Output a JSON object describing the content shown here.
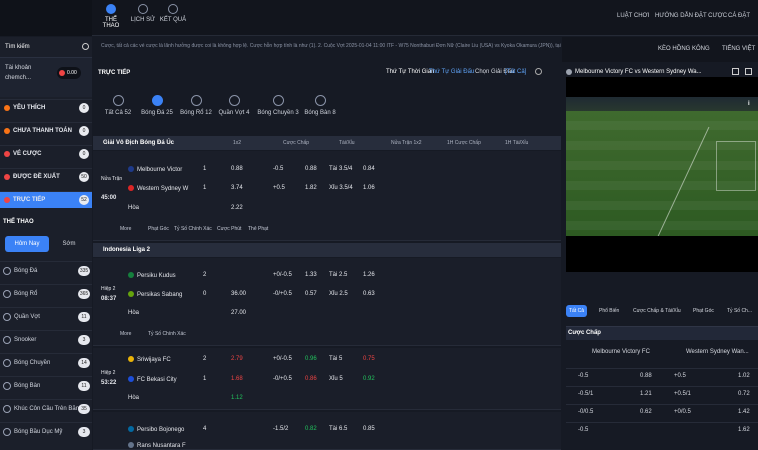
{
  "topnav": {
    "tabs": [
      {
        "label": "THỂ THAO"
      },
      {
        "label": "LỊCH SỬ"
      },
      {
        "label": "KẾT QUẢ"
      }
    ],
    "links": {
      "logout": "LUẬT CHƠI",
      "guide": "HƯỚNG DẪN ĐẶT CƯỢC",
      "odds_type": "CÁ ĐẶT"
    }
  },
  "sidebar": {
    "search_label": "Tìm kiếm",
    "account_label": "Tài khoản",
    "account_name": "chemch...",
    "balance": "0.00",
    "menu": [
      {
        "label": "YÊU THÍCH",
        "count": "0",
        "color": "#f97316"
      },
      {
        "label": "CHƯA THANH TOÁN",
        "count": "0",
        "color": "#f97316"
      },
      {
        "label": "VÉ CƯỢC",
        "count": "0",
        "color": "#ef4444"
      },
      {
        "label": "ĐƯỢC ĐỀ XUẤT",
        "count": "50",
        "color": "#ef4444"
      },
      {
        "label": "TRỰC TIẾP",
        "count": "52",
        "color": "#3b82f6"
      }
    ],
    "sports_heading": "THỂ THAO",
    "day_tabs": {
      "today": "Hôm Nay",
      "early": "Sớm"
    },
    "sports": [
      {
        "label": "Bóng Đá",
        "count": "335"
      },
      {
        "label": "Bóng Rổ",
        "count": "365"
      },
      {
        "label": "Quần Vợt",
        "count": "11"
      },
      {
        "label": "Snooker",
        "count": "3"
      },
      {
        "label": "Bóng Chuyền",
        "count": "14"
      },
      {
        "label": "Bóng Bàn",
        "count": "11"
      },
      {
        "label": "Khúc Côn Cầu Trên Băng",
        "count": "35"
      },
      {
        "label": "Bóng Bầu Dục Mỹ",
        "count": "3"
      }
    ]
  },
  "ticker": "Cược, tất cả các vé cược là lãnh hưởng được coi là không hợp lệ. Cược hỗn hợp tính là như (1). 2. Cuộc Vợt 2025-01-04 11:00 ITF - W75 Nonthaburi Đơn Nữ (Claire Liu (USA) vs Kyoka Okamura (JPN)), tại Bồ Cước. Tất cả các vé cược được hoàn trả",
  "header": {
    "title": "TRỰC TIẾP",
    "sort_label": "Thứ Tự Thời Gian",
    "sort2": "Thứ Tự Giải Đấu",
    "league_select": "Chọn Giải Đấu",
    "all_tag": "[Tất Cả]",
    "lang_select": "KÈO HỒNG KÔNG",
    "language": "TIẾNG VIỆT"
  },
  "sport_tabs": [
    {
      "label": "Tất Cả 52"
    },
    {
      "label": "Bóng Đá 25"
    },
    {
      "label": "Bóng Rổ 12"
    },
    {
      "label": "Quần Vợt 4"
    },
    {
      "label": "Bóng Chuyền 3"
    },
    {
      "label": "Bóng Bàn 8"
    }
  ],
  "columns": {
    "c1x2": "1x2",
    "handicap": "Cược Chấp",
    "ou": "Tài/Xỉu",
    "h1x2": "Nửa Trận 1x2",
    "hhandicap": "1H Cược Chấp",
    "hou": "1H Tài/Xỉu"
  },
  "leagues": [
    {
      "name": "Giải Vô Địch Bóng Đá Úc",
      "matches": [
        {
          "status": "Nửa Trận",
          "time": "45:00",
          "home": "Melbourne Victor",
          "away": "Western Sydney W",
          "draw": "Hòa",
          "hs": "1",
          "as": "1",
          "o1": "0.88",
          "o2": "3.74",
          "o3": "2.22",
          "hc1": "-0.5",
          "hc2": "+0.5",
          "hco1": "0.88",
          "hco2": "1.82",
          "ou1": "Tài 3.5/4",
          "ou2": "Xỉu 3.5/4",
          "ouo1": "0.84",
          "ouo2": "1.06",
          "more": "More",
          "corner": "Phạt Góc",
          "cs": "Tỷ Số Chính Xác",
          "ht": "Cược Phút",
          "sub": "Thẻ Phạt"
        }
      ]
    },
    {
      "name": "Indonesia Liga 2",
      "matches": [
        {
          "status": "Hiệp 2",
          "time": "08:37",
          "home": "Persiku Kudus",
          "away": "Persikas Sabang",
          "draw": "Hòa",
          "hs": "2",
          "as": "0",
          "o1": "",
          "o2": "36.00",
          "o3": "27.00",
          "hc1": "+0/-0.5",
          "hc2": "-0/+0.5",
          "hco1": "1.33",
          "hco2": "0.57",
          "ou1": "Tài 2.5",
          "ou2": "Xỉu 2.5",
          "ouo1": "1.26",
          "ouo2": "0.63",
          "more": "More",
          "cs": "Tỷ Số Chính Xác"
        },
        {
          "status": "Hiệp 2",
          "time": "53:22",
          "home": "Sriwijaya FC",
          "away": "FC Bekasi City",
          "draw": "Hòa",
          "hs": "2",
          "as": "1",
          "o1": "2.79",
          "o2": "1.68",
          "o3": "1.12",
          "hc1": "+0/-0.5",
          "hc2": "-0/+0.5",
          "hco1": "0.96",
          "hco2": "0.86",
          "ou1": "Tài 5",
          "ou2": "Xỉu 5",
          "ouo1": "0.75",
          "ouo2": "0.92"
        },
        {
          "status": "",
          "time": "",
          "home": "Persibo Bojonego",
          "away": "Rans Nusantara F",
          "draw": "",
          "hs": "4",
          "as": "",
          "o1": "",
          "o2": "",
          "o3": "",
          "hc1": "-1.5/2",
          "hc2": "",
          "hco1": "0.82",
          "hco2": "",
          "ou1": "Tài 6.5",
          "ou2": "Xỉu 6.5",
          "ouo1": "0.85",
          "ouo2": ""
        }
      ]
    }
  ],
  "stream": {
    "title": "Melbourne Victory FC vs Western Sydney Wa...",
    "tabs": [
      "Tất Cả",
      "Phổ Biến",
      "Cược Chấp & Tài/Xỉu",
      "Phạt Góc",
      "Tỷ Số Ch..."
    ],
    "market": "Cược Chấp",
    "home": "Melbourne Victory FC",
    "away": "Western Sydney Wan...",
    "rows": [
      {
        "a": "-0.5",
        "b": "0.88",
        "c": "+0.5",
        "d": "1.02"
      },
      {
        "a": "-0.5/1",
        "b": "1.21",
        "c": "+0.5/1",
        "d": "0.72"
      },
      {
        "a": "-0/0.5",
        "b": "0.62",
        "c": "+0/0.5",
        "d": "1.42"
      },
      {
        "a": "-0.5",
        "b": "",
        "c": "",
        "d": "1.62"
      }
    ]
  }
}
